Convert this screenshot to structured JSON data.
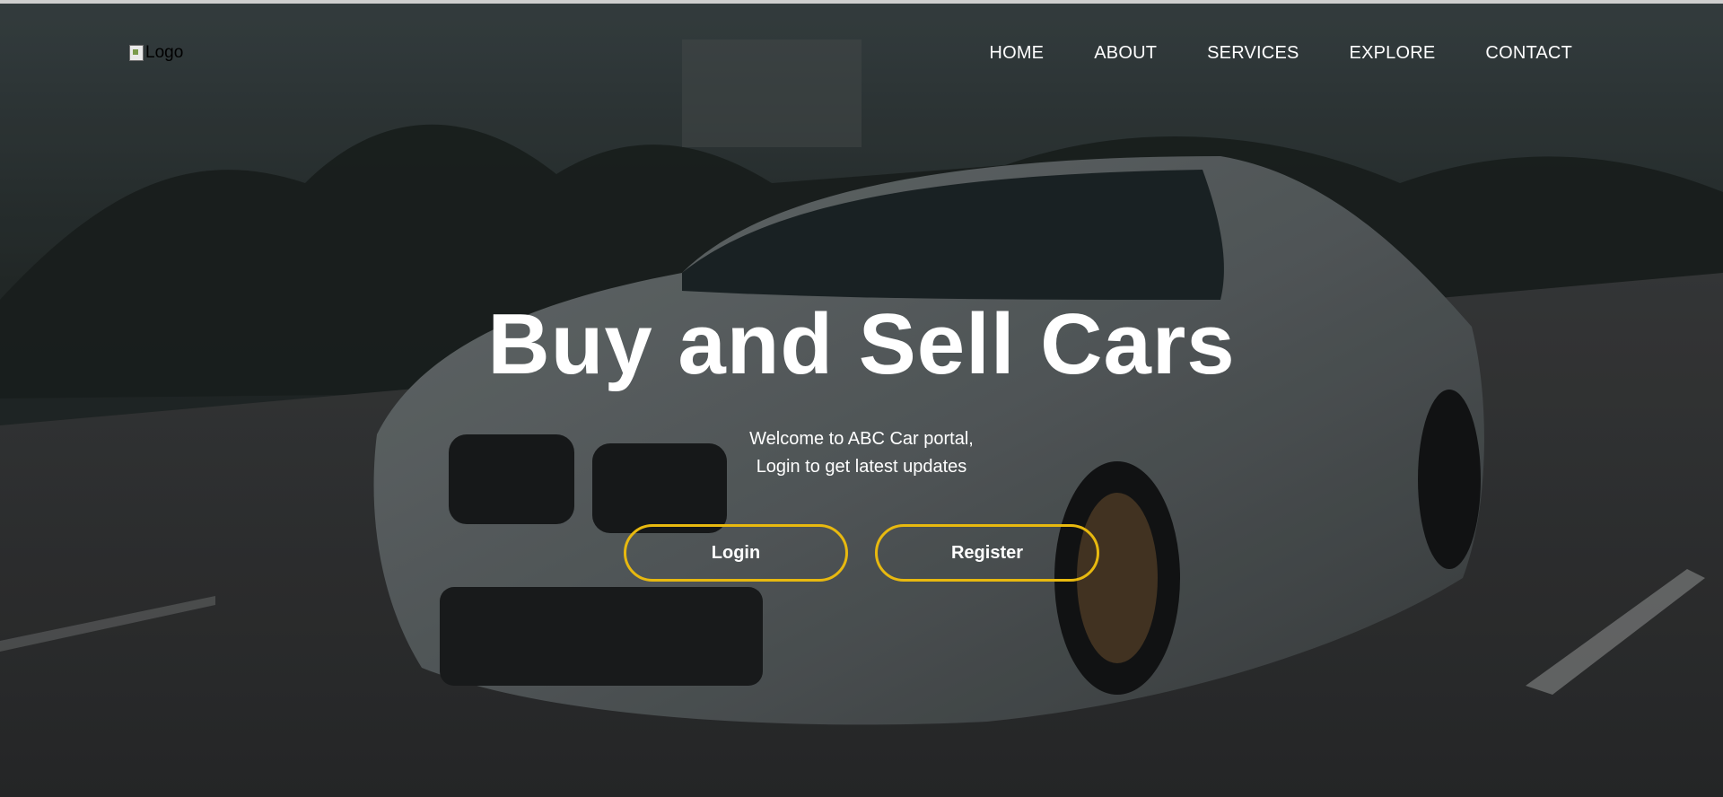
{
  "logo": {
    "alt_text": "Logo"
  },
  "nav": {
    "items": [
      {
        "label": "HOME"
      },
      {
        "label": "ABOUT"
      },
      {
        "label": "SERVICES"
      },
      {
        "label": "EXPLORE"
      },
      {
        "label": "CONTACT"
      }
    ]
  },
  "hero": {
    "headline": "Buy and Sell Cars",
    "subtitle_line1": "Welcome to ABC Car portal,",
    "subtitle_line2": "Login to get latest updates",
    "login_label": "Login",
    "register_label": "Register"
  },
  "colors": {
    "accent": "#e8b90f",
    "text": "#ffffff"
  }
}
